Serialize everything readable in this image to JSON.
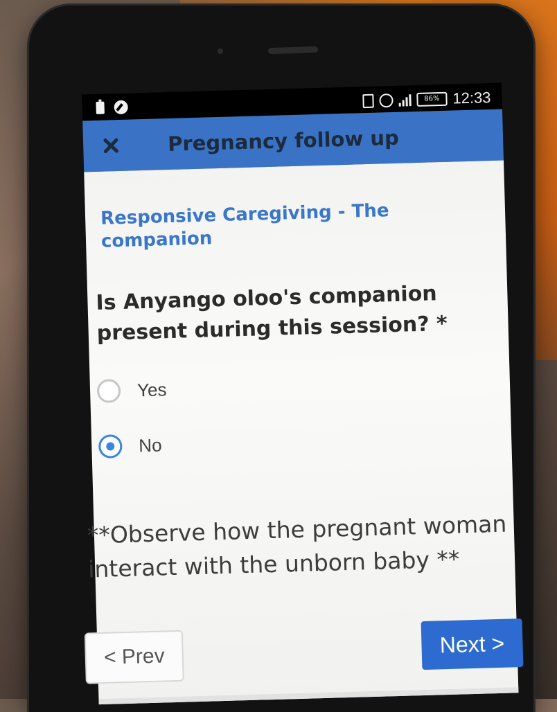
{
  "status_bar": {
    "time": "12:33",
    "battery_percent": "86%",
    "left_icons": [
      "battery-saver-icon",
      "edit-icon"
    ],
    "right_icons": [
      "vibrate-icon",
      "alarm-icon",
      "signal-icon",
      "battery-icon"
    ]
  },
  "app_bar": {
    "title": "Pregnancy follow up",
    "close_icon": "close-icon",
    "color": "#3a73c6"
  },
  "form": {
    "section_title": "Responsive Caregiving - The companion",
    "question": "Is Anyango oloo's companion present during this session? *",
    "options": [
      {
        "label": "Yes",
        "selected": false
      },
      {
        "label": "No",
        "selected": true
      }
    ],
    "note": "**Observe how the pregnant woman interact with the unborn baby **"
  },
  "navigation": {
    "prev_label": "< Prev",
    "next_label": "Next >"
  },
  "colors": {
    "accent": "#3a77c9",
    "radio_selected": "#3a85e0",
    "next_button": "#2d6bd0"
  }
}
